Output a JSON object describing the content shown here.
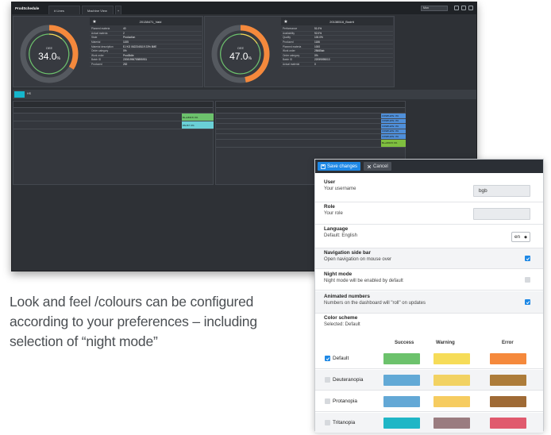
{
  "dashboard": {
    "brand": "ProdSchedule",
    "tabs": [
      "# Lines",
      "Machine View"
    ],
    "lang_select": "Mon",
    "panels": [
      {
        "title": "20138471_Vald",
        "gauge_label": "OEE",
        "gauge_value": "34.0",
        "gauge_unit": "%",
        "gauge_fraction": 0.34,
        "rows": [
          [
            "Planned materia",
            "40"
          ],
          [
            "Actual materia",
            "2"
          ],
          [
            "State",
            "Production"
          ],
          [
            "Material",
            "1155"
          ],
          [
            "Material description",
            "EJ KG 0622345119 23% 8ME"
          ],
          [
            "Order category",
            "0%"
          ],
          [
            "Work order",
            "Prod0idle"
          ],
          [
            "Batch ID",
            "22081996759895931"
          ],
          [
            "Produced",
            "252"
          ]
        ]
      },
      {
        "title": "20138516_Bodrit",
        "gauge_label": "OEE",
        "gauge_value": "47.0",
        "gauge_unit": "%",
        "gauge_fraction": 0.47,
        "rows": [
          [
            "Performance",
            "51.0%"
          ],
          [
            "Availability",
            "92.0%"
          ],
          [
            "Quality",
            "100.0%"
          ],
          [
            "Produced",
            "1186"
          ],
          [
            "Planned materia",
            "1000"
          ],
          [
            "Work order",
            "25665ab"
          ],
          [
            "Order category",
            "0%"
          ],
          [
            "Batch ID",
            "22059095013"
          ],
          [
            "Actual material",
            "0"
          ]
        ]
      }
    ],
    "cyan_label": "HS",
    "badges_left": [
      "BL+1830 8: 0%",
      "PAUS7: 0%"
    ],
    "badges_right": [
      "COMPLETE: 0%",
      "COMPLETE: 0%",
      "COMPLETE: 0%",
      "COMPLETE: 0%",
      "COMPLETE: 0%",
      "BL+1830 8: 0%"
    ]
  },
  "settings": {
    "save_label": "Save changes",
    "cancel_label": "Cancel",
    "user": {
      "title": "User",
      "desc": "Your username",
      "value": "bgb"
    },
    "role": {
      "title": "Role",
      "desc": "Your role",
      "value": ""
    },
    "language": {
      "title": "Language",
      "desc": "Default: English",
      "value": "en"
    },
    "nav_sidebar": {
      "title": "Navigation side bar",
      "desc": "Open navigation on mouse over",
      "checked": true
    },
    "night_mode": {
      "title": "Night mode",
      "desc": "Night mode will be enabled by default",
      "checked": false
    },
    "animated": {
      "title": "Animated numbers",
      "desc": "Numbers on the dashboard will \"roll\" on updates",
      "checked": true
    },
    "color_scheme": {
      "title": "Color scheme",
      "desc": "Selected: Default",
      "columns": [
        "Success",
        "Warning",
        "Error"
      ],
      "schemes": [
        {
          "name": "Default",
          "checked": true,
          "colors": [
            "#6cc26c",
            "#f6dc58",
            "#f5893c"
          ]
        },
        {
          "name": "Deuteranopia",
          "checked": false,
          "colors": [
            "#62a9d6",
            "#f2d262",
            "#ad7c3a"
          ]
        },
        {
          "name": "Protanopia",
          "checked": false,
          "colors": [
            "#63a8d6",
            "#f6cc60",
            "#9f6a35"
          ]
        },
        {
          "name": "Tritanopia",
          "checked": false,
          "colors": [
            "#20b6c6",
            "#9a7c80",
            "#e05a6e"
          ]
        }
      ]
    }
  },
  "caption": {
    "line1": "Look and feel  /colours can be configured",
    "line2": "according to your preferences – including",
    "line3": "selection of “night mode”"
  },
  "colors": {
    "accent": "#1e88e5",
    "gauge_orange": "#f5893c",
    "cyan": "#16b6cc",
    "dark_bg": "#2e3136"
  }
}
